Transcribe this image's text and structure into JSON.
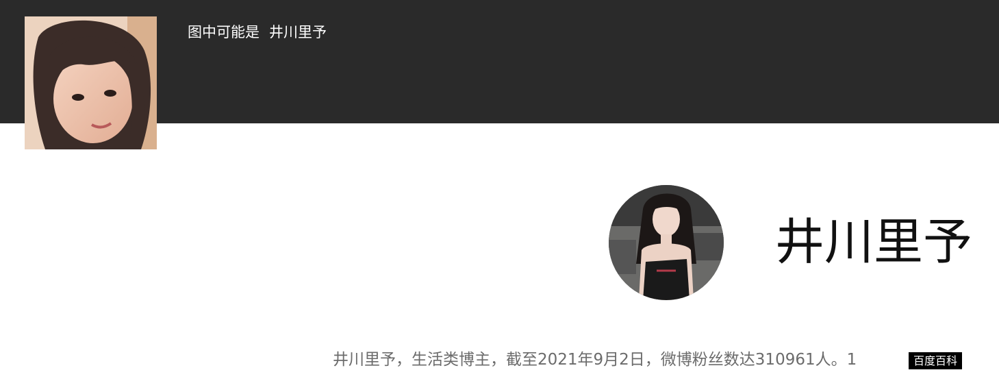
{
  "header": {
    "prefix": "图中可能是",
    "name": "井川里予"
  },
  "profile": {
    "name": "井川里予"
  },
  "description": {
    "text": "井川里予，生活类博主，截至2021年9月2日，微博粉丝数达310961人。1"
  },
  "source": {
    "label": "百度百科"
  },
  "colors": {
    "header_bg": "#2a2a2a",
    "description_text": "#6b6b6b",
    "badge_bg": "#000000"
  }
}
